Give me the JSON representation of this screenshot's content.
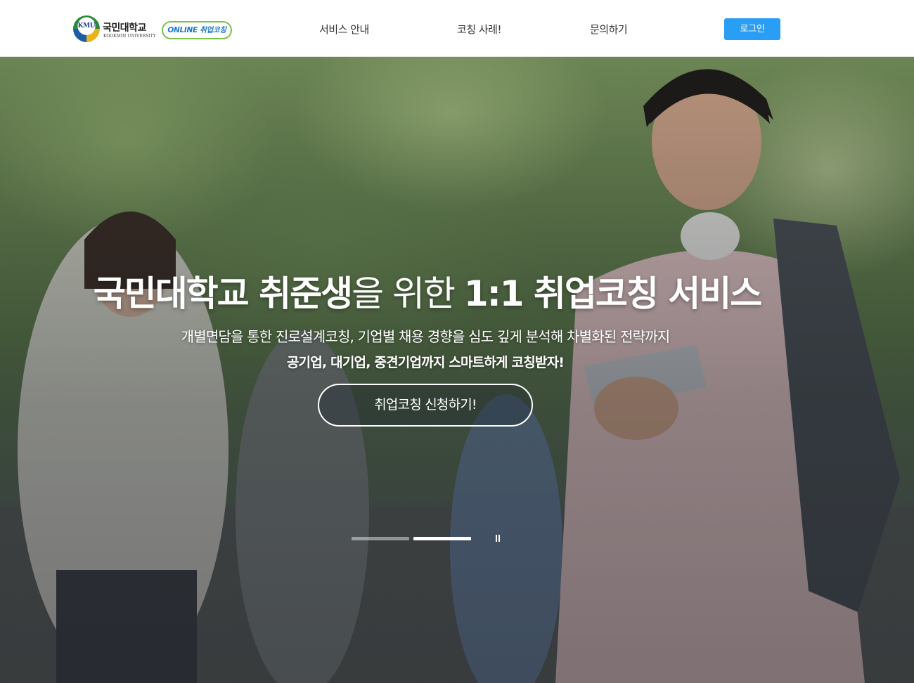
{
  "header": {
    "logo": {
      "emblem_text": "KMU",
      "university_name_kr": "국민대학교",
      "university_name_en": "KOOKMIN UNIVERSITY",
      "badge": "ONLINE 취업코칭"
    },
    "nav": [
      {
        "label": "서비스 안내"
      },
      {
        "label": "코칭 사례!"
      },
      {
        "label": "문의하기"
      }
    ],
    "login_label": "로그인"
  },
  "hero": {
    "title_bold_1": "국민대학교 취준생",
    "title_light": "을 위한 ",
    "title_bold_2": "1:1 취업코칭 서비스",
    "subtitle": "개별면담을 통한 진로설계코칭, 기업별 채용 경향을 심도 깊게 분석해 차별화된 전략까지",
    "tagline": "공기업, 대기업, 중견기업까지 스마트하게 코칭받자!",
    "cta_label": "취업코칭 신청하기!",
    "slider": {
      "total_slides": 2,
      "active_slide": 2
    }
  },
  "colors": {
    "login_button": "#2a9df4",
    "badge_border": "#7cc24a",
    "badge_text": "#1e78c8"
  }
}
